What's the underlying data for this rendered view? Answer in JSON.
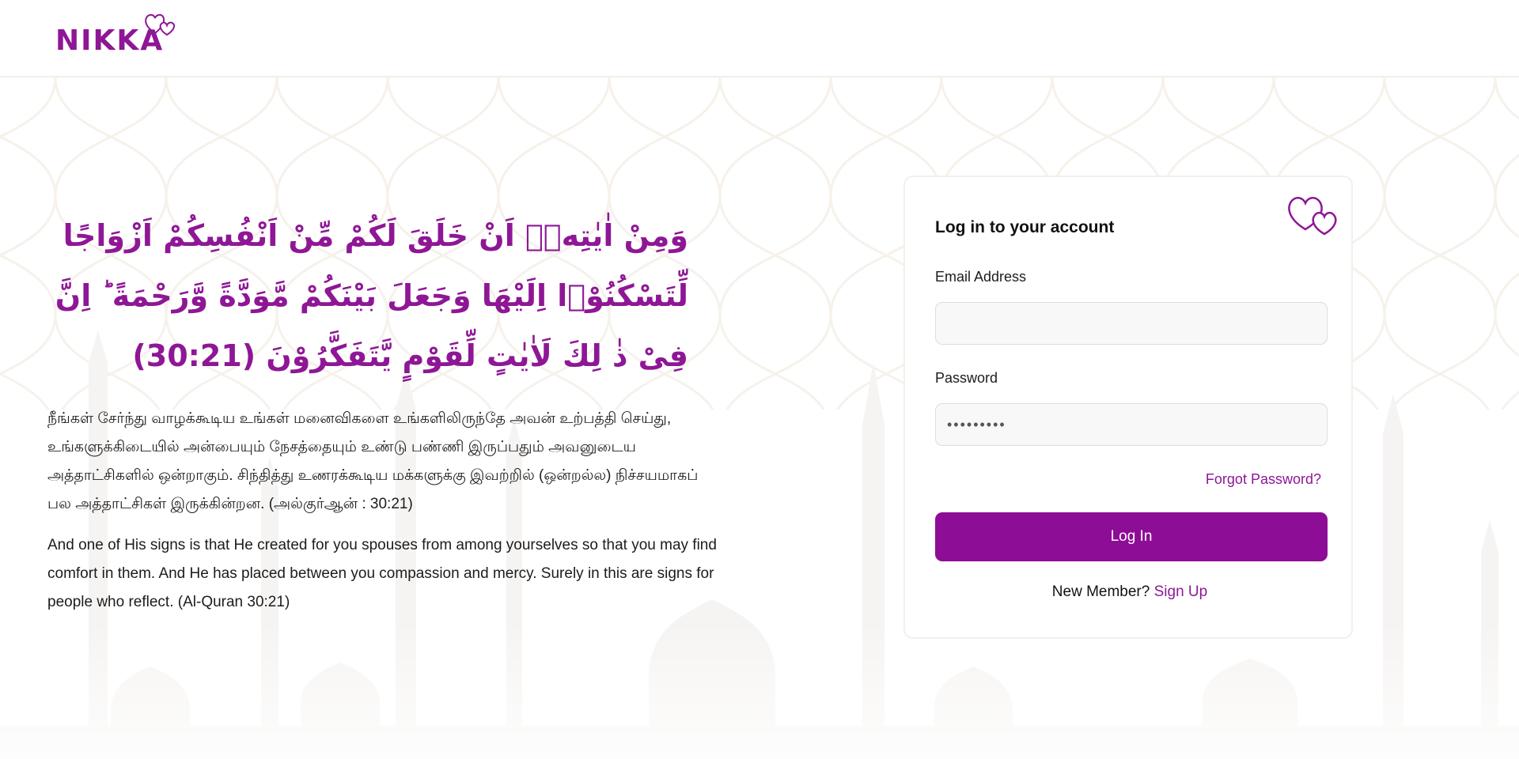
{
  "brand": {
    "name": "NIKKA",
    "color": "#8e1796"
  },
  "verse": {
    "arabic": "وَمِنْ اٰيٰتِهٖۤ اَنْ خَلَقَ لَكُمْ مِّنْ اَنْفُسِكُمْ اَزْوَاجًا لِّتَسْكُنُوْۤا اِلَيْهَا وَجَعَلَ بَيْنَكُمْ مَّوَدَّةً وَّرَحْمَةً ؕ اِنَّ فِىْ ذٰ لِكَ لَاٰيٰتٍ لِّقَوْمٍ يَّتَفَكَّرُوْنَ (30:21)",
    "tamil": "நீங்கள் சேர்ந்து வாழக்கூடிய உங்கள் மனைவிகளை உங்களிலிருந்தே அவன் உற்பத்தி செய்து, உங்களுக்கிடையில் அன்பையும் நேசத்தையும் உண்டு பண்ணி இருப்பதும் அவனுடைய அத்தாட்சிகளில் ஒன்றாகும். சிந்தித்து உணரக்கூடிய மக்களுக்கு இவற்றில் (ஒன்றல்ல) நிச்சயமாகப் பல அத்தாட்சிகள் இருக்கின்றன. (அல்குர்ஆன் : 30:21)",
    "english": "And one of His signs is that He created for you spouses from among yourselves so that you may find comfort in them. And He has placed between you compassion and mercy. Surely in this are signs for people who reflect. (Al-Quran 30:21)"
  },
  "login": {
    "title": "Log in to your account",
    "email_label": "Email Address",
    "email_value": "",
    "password_label": "Password",
    "password_value": "•••••••••",
    "forgot_label": "Forgot Password?",
    "submit_label": "Log In",
    "new_member_text": "New Member?",
    "signup_label": "Sign Up",
    "icon": "hearts-icon"
  },
  "colors": {
    "accent": "#8e1796",
    "button": "#8e0d96",
    "card_border": "#f4efe9"
  }
}
